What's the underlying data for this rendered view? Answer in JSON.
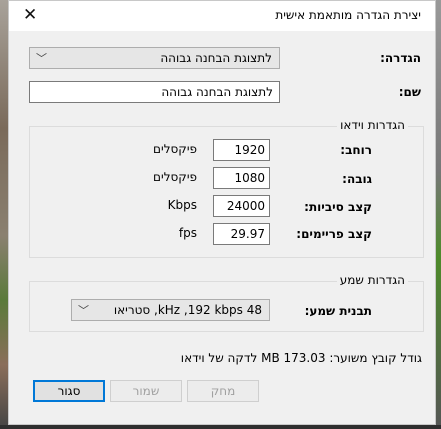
{
  "dialog": {
    "title": "יצירת הגדרה מותאמת אישית",
    "close_glyph": "✕"
  },
  "setting": {
    "label": "הגדרה:",
    "value": "לתצוגת הבחנה גבוהה"
  },
  "name": {
    "label": "שם:",
    "value": "לתצוגת הבחנה גבוהה"
  },
  "video": {
    "group_title": "הגדרות וידאו",
    "width_label": "רוחב:",
    "width_value": "1920",
    "width_unit": "פיקסלים",
    "height_label": "גובה:",
    "height_value": "1080",
    "height_unit": "פיקסלים",
    "bitrate_label": "קצב סיביות:",
    "bitrate_value": "24000",
    "bitrate_unit": "Kbps",
    "framerate_label": "קצב פריימים:",
    "framerate_value": "29.97",
    "framerate_unit": "fps"
  },
  "audio": {
    "group_title": "הגדרות שמע",
    "format_label": "תבנית שמע:",
    "format_value": "48 kHz ,192 kbps, סטריאו"
  },
  "file_size_info": "גודל קובץ משוער: 173.03 MB לדקה של וידאו",
  "buttons": {
    "delete": "מחק",
    "save": "שמור",
    "close": "סגור"
  }
}
